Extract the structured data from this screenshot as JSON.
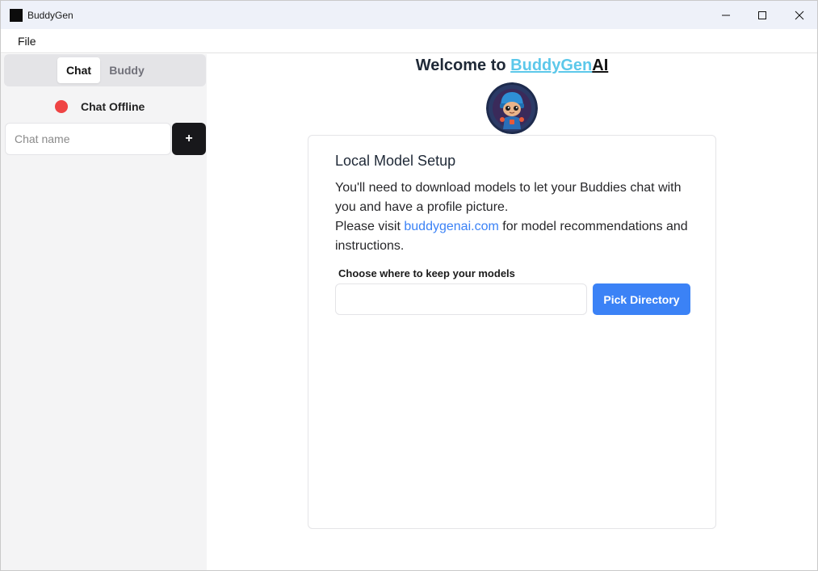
{
  "window": {
    "title": "BuddyGen"
  },
  "menubar": {
    "file_label": "File"
  },
  "sidebar": {
    "tabs": [
      {
        "label": "Chat",
        "active": true
      },
      {
        "label": "Buddy",
        "active": false
      }
    ],
    "status": {
      "text": "Chat Offline",
      "color": "#ef4444"
    },
    "chat_name_placeholder": "Chat name",
    "add_button_label": "+"
  },
  "main": {
    "welcome_prefix": "Welcome to ",
    "brand_link": "BuddyGen",
    "brand_suffix": "AI",
    "card": {
      "title": "Local Model Setup",
      "line1": " You'll need to download models to let your Buddies chat with you and have a profile picture.",
      "line2_prefix": " Please visit ",
      "link_text": "buddygenai.com",
      "line2_suffix": " for model recommendations and instructions.",
      "directory_label": "Choose where to keep your models",
      "directory_value": "",
      "pick_button_label": "Pick Directory"
    }
  },
  "colors": {
    "accent": "#3b82f6",
    "brand": "#5cc8ea",
    "status_offline": "#ef4444"
  }
}
